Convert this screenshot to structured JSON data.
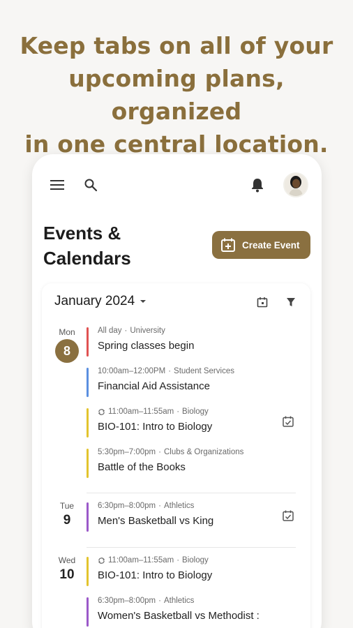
{
  "headline": {
    "line1": "Keep tabs on all of your",
    "line2": "upcoming plans, organized",
    "line3": "in one central location."
  },
  "appbar": {
    "menu_icon": "hamburger-menu-icon",
    "search_icon": "search-icon",
    "bell_icon": "notification-bell-icon",
    "avatar": "user-avatar"
  },
  "page": {
    "title_line1": "Events &",
    "title_line2": "Calendars",
    "create_button": "Create Event"
  },
  "calendar": {
    "month": "January 2024",
    "days": [
      {
        "dow": "Mon",
        "num": "8",
        "selected": true,
        "events": [
          {
            "time": "All day",
            "category": "University",
            "title": "Spring classes begin",
            "color": "#e05252",
            "recurring": false,
            "has_check": false
          },
          {
            "time": "10:00am–12:00PM",
            "category": "Student Services",
            "title": "Financial Aid Assistance",
            "color": "#5b8fe0",
            "recurring": false,
            "has_check": false
          },
          {
            "time": "11:00am–11:55am",
            "category": "Biology",
            "title": "BIO-101: Intro to Biology",
            "color": "#e3c42e",
            "recurring": true,
            "has_check": true
          },
          {
            "time": "5:30pm–7:00pm",
            "category": "Clubs & Organizations",
            "title": "Battle of the Books",
            "color": "#e3c42e",
            "recurring": false,
            "has_check": false
          }
        ]
      },
      {
        "dow": "Tue",
        "num": "9",
        "selected": false,
        "events": [
          {
            "time": "6:30pm–8:00pm",
            "category": "Athletics",
            "title": "Men's Basketball vs King",
            "color": "#9b59c9",
            "recurring": false,
            "has_check": true
          }
        ]
      },
      {
        "dow": "Wed",
        "num": "10",
        "selected": false,
        "events": [
          {
            "time": "11:00am–11:55am",
            "category": "Biology",
            "title": "BIO-101: Intro to Biology",
            "color": "#e3c42e",
            "recurring": true,
            "has_check": false
          },
          {
            "time": "6:30pm–8:00pm",
            "category": "Athletics",
            "title": "Women's Basketball vs Methodist :",
            "color": "#9b59c9",
            "recurring": false,
            "has_check": false
          }
        ]
      }
    ]
  }
}
